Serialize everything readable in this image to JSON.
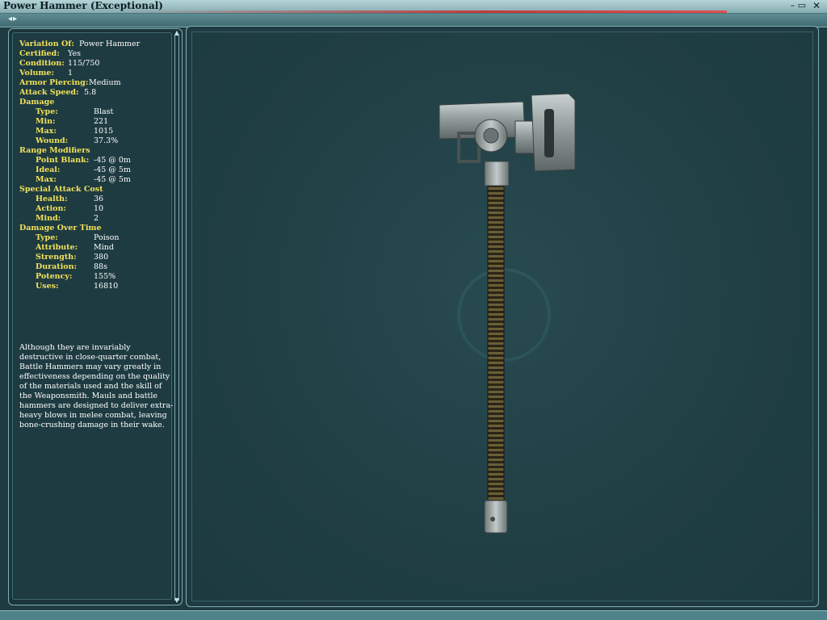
{
  "window": {
    "title": "Power Hammer (Exceptional)",
    "window_controls": "– ▭",
    "close_glyph": "✕"
  },
  "nav": {
    "arrows": "◂▸"
  },
  "attributes": {
    "variation_of": {
      "label": "Variation Of:",
      "value": "Power Hammer"
    },
    "certified": {
      "label": "Certified:",
      "value": "Yes"
    },
    "condition": {
      "label": "Condition:",
      "value": "115/750"
    },
    "volume": {
      "label": "Volume:",
      "value": "1"
    },
    "armor_piercing": {
      "label": "Armor Piercing:",
      "value": "Medium"
    },
    "attack_speed": {
      "label": "Attack Speed:",
      "value": "5.8"
    },
    "damage": {
      "header": "Damage",
      "type": {
        "label": "Type:",
        "value": "Blast"
      },
      "min": {
        "label": "Min:",
        "value": "221"
      },
      "max": {
        "label": "Max:",
        "value": "1015"
      },
      "wound": {
        "label": "Wound:",
        "value": "37.3%"
      }
    },
    "range_modifiers": {
      "header": "Range Modifiers",
      "point_blank": {
        "label": "Point Blank:",
        "value": "-45 @  0m"
      },
      "ideal": {
        "label": "Ideal:",
        "value": "-45 @  5m"
      },
      "max": {
        "label": "Max:",
        "value": "-45 @  5m"
      }
    },
    "special_attack_cost": {
      "header": "Special Attack Cost",
      "health": {
        "label": "Health:",
        "value": "36"
      },
      "action": {
        "label": "Action:",
        "value": "10"
      },
      "mind": {
        "label": "Mind:",
        "value": "2"
      }
    },
    "damage_over_time": {
      "header": "Damage Over Time",
      "type": {
        "label": "Type:",
        "value": "Poison"
      },
      "attribute": {
        "label": "Attribute:",
        "value": "Mind"
      },
      "strength": {
        "label": "Strength:",
        "value": "380"
      },
      "duration": {
        "label": "Duration:",
        "value": "88s"
      },
      "potency": {
        "label": "Potency:",
        "value": "155%"
      },
      "uses": {
        "label": "Uses:",
        "value": "16810"
      }
    }
  },
  "description": "Although they are invariably destructive in close-quarter combat, Battle Hammers may vary greatly in effectiveness depending on the quality of the materials used and the skill of the Weaponsmith.  Mauls and battle hammers are designed to deliver extra-heavy blows in melee combat, leaving bone-crushing damage in their wake.",
  "scroll": {
    "up": "▲",
    "down": "▼"
  },
  "colors": {
    "label_yellow": "#f2e15a",
    "value_white": "#ffffff",
    "frame_cyan": "#7cb0b6",
    "viewer_bg": "#203f45"
  }
}
